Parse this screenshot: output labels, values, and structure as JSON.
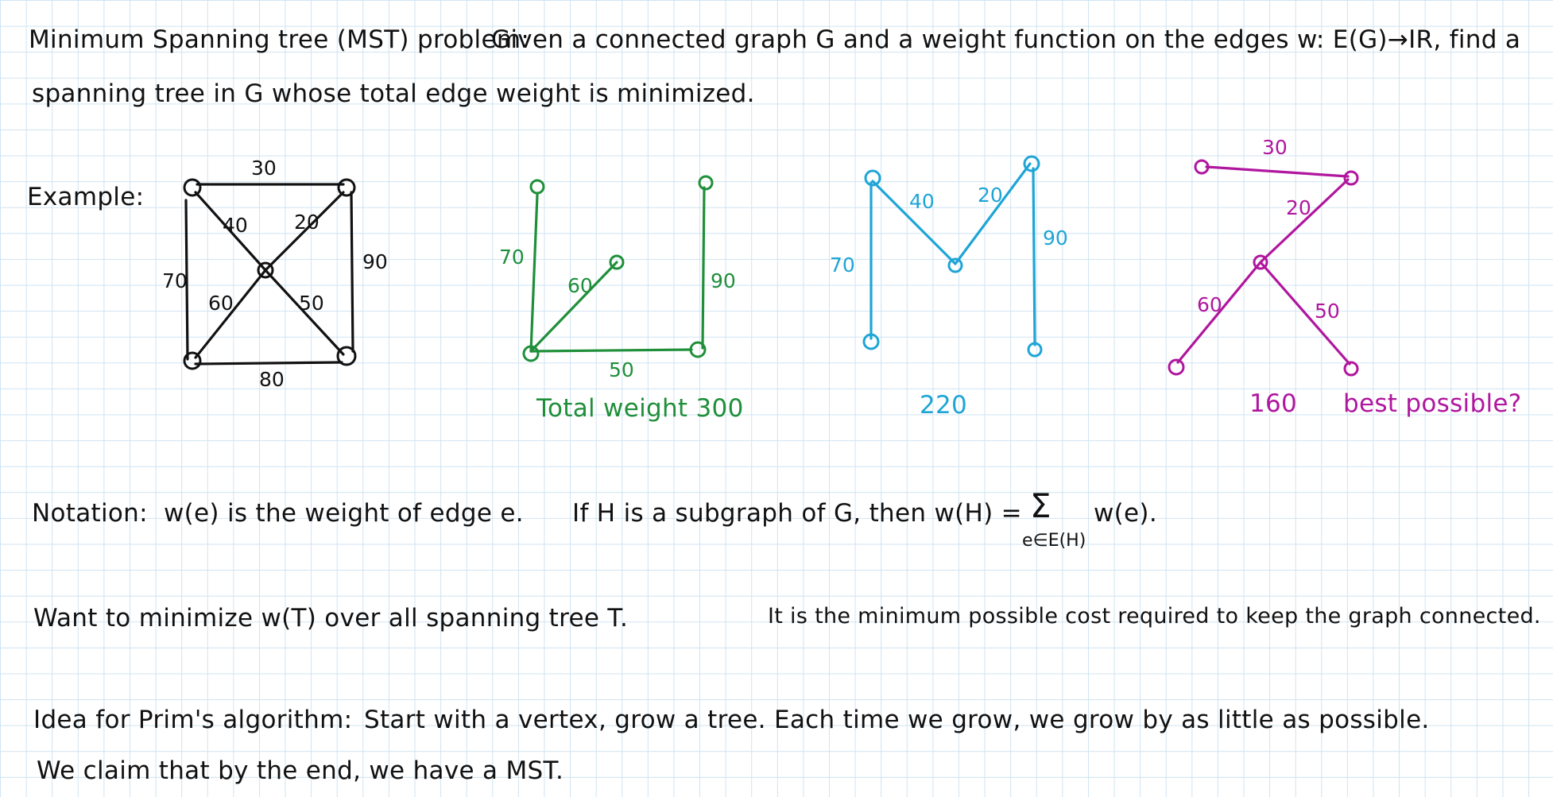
{
  "heading": {
    "term": "Minimum Spanning tree (MST) problem:",
    "line1": "Given a connected graph G and a weight function on the edges w: E(G)→IR, find a",
    "line2": "spanning tree in G whose total edge weight is minimized."
  },
  "example": {
    "label": "Example:",
    "graph": {
      "edge_weights": {
        "top": "30",
        "upper_left_diag": "40",
        "upper_right_diag": "20",
        "left": "70",
        "right": "90",
        "lower_left_diag": "60",
        "lower_right_diag": "50",
        "bottom": "80"
      }
    },
    "tree1": {
      "color": "#1f8f3a",
      "weights": {
        "left": "70",
        "diag": "60",
        "bottom": "50",
        "right": "90"
      },
      "caption": "Total weight 300"
    },
    "tree2": {
      "color": "#1ea5d6",
      "weights": {
        "left": "70",
        "diag_left": "40",
        "diag_right": "20",
        "right": "90"
      },
      "caption": "220"
    },
    "tree3": {
      "color": "#b0169e",
      "weights": {
        "top": "30",
        "upper": "20",
        "lower_left": "60",
        "lower_right": "50"
      },
      "caption": "160",
      "note": "best possible?"
    }
  },
  "notation": {
    "label": "Notation:",
    "text1": "w(e) is the weight of edge e.",
    "text2": "If H is a subgraph of G, then w(H) =",
    "sigma": "Σ",
    "sum_term": "w(e).",
    "sum_index": "e∈E(H)"
  },
  "want": {
    "text1": "Want to minimize w(T) over all spanning tree T.",
    "text2": "It is the minimum possible cost required to keep the graph connected."
  },
  "idea": {
    "label": "Idea for Prim's algorithm:",
    "text1": "Start with a vertex, grow a tree. Each time we grow, we grow by as little as possible.",
    "text2": "We claim that by the end, we have a MST."
  }
}
